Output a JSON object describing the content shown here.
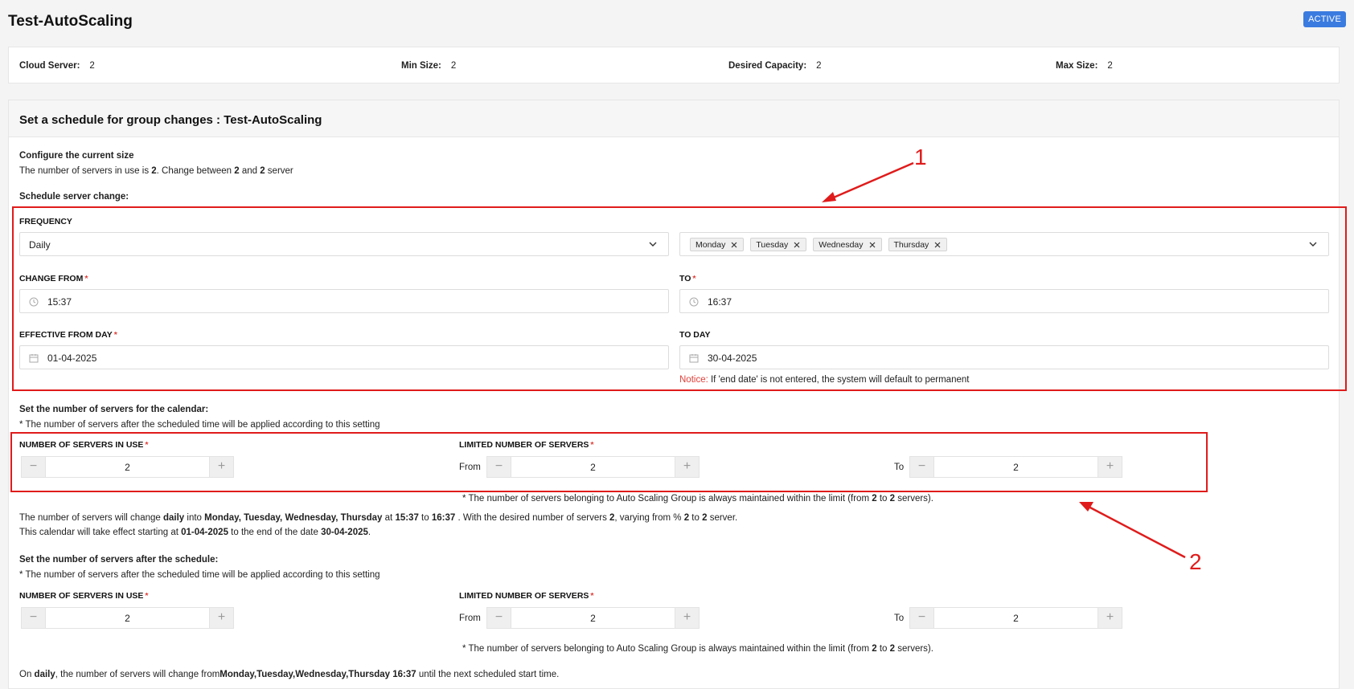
{
  "header": {
    "title": "Test-AutoScaling",
    "status": "ACTIVE"
  },
  "summary": [
    {
      "label": "Cloud Server:",
      "value": "2"
    },
    {
      "label": "Min Size:",
      "value": "2"
    },
    {
      "label": "Desired Capacity:",
      "value": "2"
    },
    {
      "label": "Max Size:",
      "value": "2"
    }
  ],
  "schedule": {
    "title": "Set a schedule for group changes : Test-AutoScaling",
    "configure_title": "Configure the current size",
    "configure_desc": {
      "pre": "The number of servers in use is ",
      "current": "2",
      "mid": ". Change between ",
      "min": "2",
      "and": " and ",
      "max": "2",
      "post": " server"
    },
    "schedule_label": "Schedule server change:",
    "frequency": {
      "label": "FREQUENCY",
      "value": "Daily",
      "days": [
        "Monday",
        "Tuesday",
        "Wednesday",
        "Thursday"
      ]
    },
    "change_from": {
      "label": "CHANGE FROM",
      "value": "15:37"
    },
    "change_to": {
      "label": "TO",
      "value": "16:37"
    },
    "effective_from": {
      "label": "EFFECTIVE FROM DAY",
      "value": "01-04-2025"
    },
    "to_day": {
      "label": "TO DAY",
      "value": "30-04-2025"
    },
    "notice": {
      "word": "Notice:",
      "text": " If 'end date' is not entered, the system will default to permanent"
    },
    "required_mark": "*"
  },
  "calendar": {
    "title": "Set the number of servers for the calendar:",
    "note": "* The number of servers after the scheduled time will be applied according to this setting",
    "in_use_label": "NUMBER OF SERVERS IN USE",
    "in_use_value": "2",
    "limited_label": "LIMITED NUMBER OF SERVERS",
    "from_label": "From",
    "from_value": "2",
    "to_label": "To",
    "to_value": "2",
    "limit_note": {
      "pre": "* The number of servers belonging to Auto Scaling Group is always maintained within the limit (from ",
      "a": "2",
      "mid": " to ",
      "b": "2",
      "post": " servers)."
    }
  },
  "summary_text": {
    "line1": {
      "p1": "The number of servers will change ",
      "freq": "daily",
      "p2": " into ",
      "days": "Monday, Tuesday, Wednesday, Thursday",
      "p3": " at ",
      "from": "15:37",
      "p4": " to ",
      "to": "16:37",
      "p5": " . With the desired number of servers ",
      "desired": "2",
      "p6": ", varying from % ",
      "min": "2",
      "p7": " to ",
      "max": "2",
      "p8": " server."
    },
    "line2": {
      "p1": "This calendar will take effect starting at ",
      "start": "01-04-2025",
      "p2": " to the end of the date ",
      "end": "30-04-2025",
      "p3": "."
    }
  },
  "after": {
    "title": "Set the number of servers after the schedule:",
    "note": "* The number of servers after the scheduled time will be applied according to this setting",
    "in_use_label": "NUMBER OF SERVERS IN USE",
    "in_use_value": "2",
    "limited_label": "LIMITED NUMBER OF SERVERS",
    "from_label": "From",
    "from_value": "2",
    "to_label": "To",
    "to_value": "2",
    "limit_note": {
      "pre": "* The number of servers belonging to Auto Scaling Group is always maintained within the limit (from ",
      "a": "2",
      "mid": " to ",
      "b": "2",
      "post": " servers)."
    }
  },
  "footer_line": {
    "p1": "On ",
    "freq": "daily",
    "p2": ", the number of servers will change from",
    "days": "Monday,Tuesday,Wednesday,Thursday 16:37",
    "p3": " until the next scheduled start time."
  },
  "stepper_symbols": {
    "minus": "−",
    "plus": "+"
  },
  "annotations": {
    "one": "1",
    "two": "2"
  },
  "colors": {
    "accent": "#3a7be0",
    "annotation": "#e01b1b",
    "required": "#e0403a"
  },
  "icons": {
    "dropdown": "chevron-down-icon",
    "tag_remove": "close-icon",
    "time": "clock-icon",
    "date": "calendar-icon"
  }
}
